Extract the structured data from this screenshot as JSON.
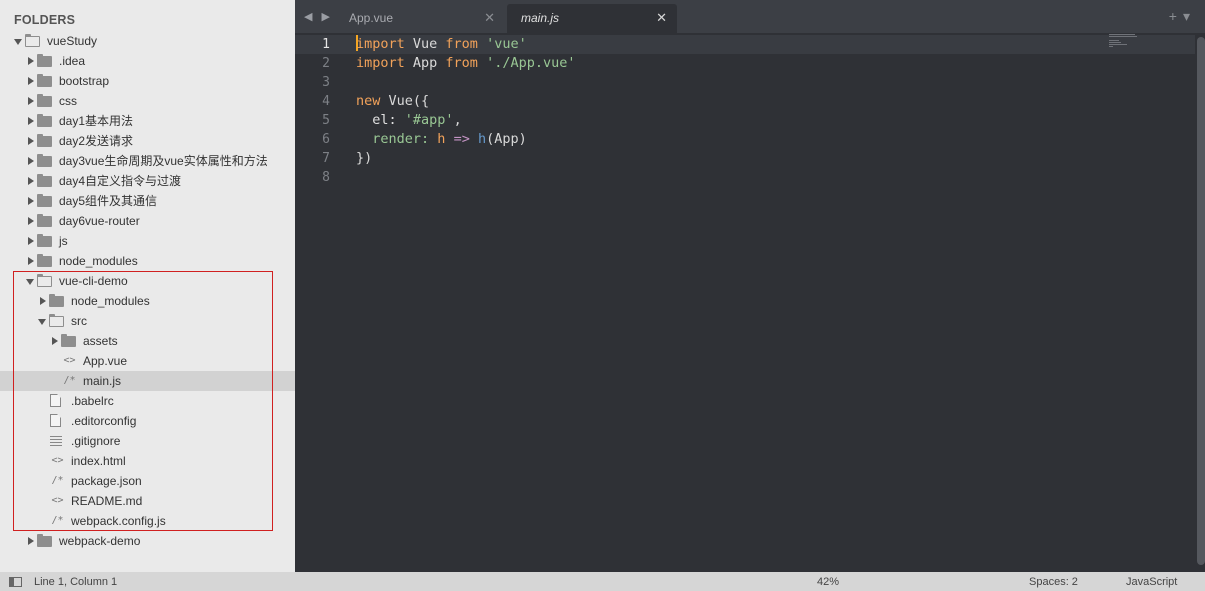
{
  "sidebar": {
    "title": "FOLDERS",
    "items": [
      {
        "label": "vueStudy",
        "depth": 0,
        "type": "folder",
        "expanded": true
      },
      {
        "label": ".idea",
        "depth": 1,
        "type": "folder",
        "expanded": false
      },
      {
        "label": "bootstrap",
        "depth": 1,
        "type": "folder",
        "expanded": false
      },
      {
        "label": "css",
        "depth": 1,
        "type": "folder",
        "expanded": false
      },
      {
        "label": "day1基本用法",
        "depth": 1,
        "type": "folder",
        "expanded": false
      },
      {
        "label": "day2发送请求",
        "depth": 1,
        "type": "folder",
        "expanded": false
      },
      {
        "label": "day3vue生命周期及vue实体属性和方法",
        "depth": 1,
        "type": "folder",
        "expanded": false
      },
      {
        "label": "day4自定义指令与过渡",
        "depth": 1,
        "type": "folder",
        "expanded": false
      },
      {
        "label": "day5组件及其通信",
        "depth": 1,
        "type": "folder",
        "expanded": false
      },
      {
        "label": "day6vue-router",
        "depth": 1,
        "type": "folder",
        "expanded": false
      },
      {
        "label": "js",
        "depth": 1,
        "type": "folder",
        "expanded": false
      },
      {
        "label": "node_modules",
        "depth": 1,
        "type": "folder",
        "expanded": false
      },
      {
        "label": "vue-cli-demo",
        "depth": 1,
        "type": "folder",
        "expanded": true
      },
      {
        "label": "node_modules",
        "depth": 2,
        "type": "folder",
        "expanded": false
      },
      {
        "label": "src",
        "depth": 2,
        "type": "folder",
        "expanded": true
      },
      {
        "label": "assets",
        "depth": 3,
        "type": "folder",
        "expanded": false
      },
      {
        "label": "App.vue",
        "depth": 3,
        "type": "file",
        "icon": "angle-brackets-icon",
        "glyph": "<>"
      },
      {
        "label": "main.js",
        "depth": 3,
        "type": "file",
        "icon": "comment-slash-icon",
        "glyph": "/*",
        "selected": true
      },
      {
        "label": ".babelrc",
        "depth": 2,
        "type": "file",
        "icon": "document-icon"
      },
      {
        "label": ".editorconfig",
        "depth": 2,
        "type": "file",
        "icon": "document-icon"
      },
      {
        "label": ".gitignore",
        "depth": 2,
        "type": "file",
        "icon": "lines-icon"
      },
      {
        "label": "index.html",
        "depth": 2,
        "type": "file",
        "icon": "angle-brackets-icon",
        "glyph": "<>"
      },
      {
        "label": "package.json",
        "depth": 2,
        "type": "file",
        "icon": "comment-slash-icon",
        "glyph": "/*"
      },
      {
        "label": "README.md",
        "depth": 2,
        "type": "file",
        "icon": "angle-brackets-icon",
        "glyph": "<>"
      },
      {
        "label": "webpack.config.js",
        "depth": 2,
        "type": "file",
        "icon": "comment-slash-icon",
        "glyph": "/*"
      },
      {
        "label": "webpack-demo",
        "depth": 1,
        "type": "folder",
        "expanded": false
      }
    ]
  },
  "tabs": [
    {
      "label": "App.vue",
      "active": false
    },
    {
      "label": "main.js",
      "active": true
    }
  ],
  "editor": {
    "current_line": 1,
    "lines": [
      {
        "n": "1",
        "tokens": [
          {
            "t": "import",
            "c": "kw"
          },
          {
            "t": " Vue ",
            "c": ""
          },
          {
            "t": "from",
            "c": "kw"
          },
          {
            "t": " ",
            "c": ""
          },
          {
            "t": "'vue'",
            "c": "str"
          }
        ]
      },
      {
        "n": "2",
        "tokens": [
          {
            "t": "import",
            "c": "kw"
          },
          {
            "t": " App ",
            "c": ""
          },
          {
            "t": "from",
            "c": "kw"
          },
          {
            "t": " ",
            "c": ""
          },
          {
            "t": "'./App.vue'",
            "c": "str"
          }
        ]
      },
      {
        "n": "3",
        "tokens": []
      },
      {
        "n": "4",
        "tokens": [
          {
            "t": "new",
            "c": "kw"
          },
          {
            "t": " Vue({",
            "c": ""
          }
        ]
      },
      {
        "n": "5",
        "tokens": [
          {
            "t": "  el: ",
            "c": "prop"
          },
          {
            "t": "'#app'",
            "c": "str"
          },
          {
            "t": ",",
            "c": ""
          }
        ]
      },
      {
        "n": "6",
        "tokens": [
          {
            "t": "  render: ",
            "c": "str"
          },
          {
            "t": "h",
            "c": "kw"
          },
          {
            "t": " ",
            "c": ""
          },
          {
            "t": "=>",
            "c": "ar"
          },
          {
            "t": " ",
            "c": ""
          },
          {
            "t": "h",
            "c": "fn"
          },
          {
            "t": "(App)",
            "c": ""
          }
        ]
      },
      {
        "n": "7",
        "tokens": [
          {
            "t": "})",
            "c": ""
          }
        ]
      },
      {
        "n": "8",
        "tokens": []
      }
    ]
  },
  "statusbar": {
    "position": "Line 1, Column 1",
    "zoom": "42%",
    "indent": "Spaces: 2",
    "syntax": "JavaScript"
  },
  "colors": {
    "highlight_box": "#d02020",
    "keyword": "#f2a25a",
    "string": "#99c794",
    "cursor": "#f5a623"
  }
}
